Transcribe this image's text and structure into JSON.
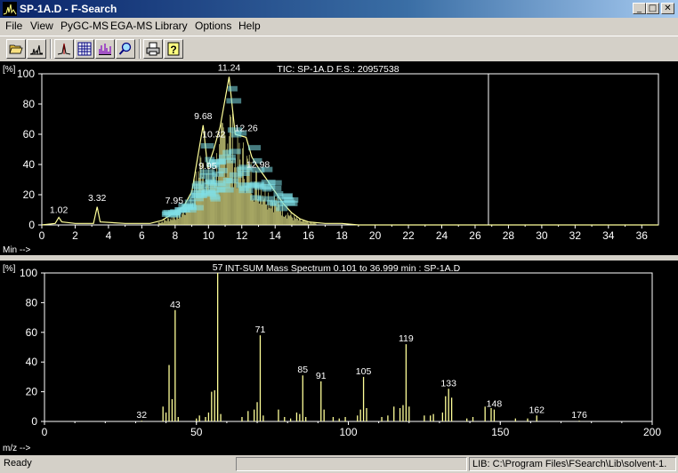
{
  "window": {
    "title": "SP-1A.D - F-Search",
    "min_glyph": "_",
    "max_glyph": "□",
    "close_glyph": "✕"
  },
  "menu": [
    "File",
    "View",
    "PyGC-MS",
    "EGA-MS",
    "Library",
    "Options",
    "Help"
  ],
  "toolbar": [
    "open-folder-icon",
    "chromatogram-icon",
    "peak-icon",
    "grid-icon",
    "spectrum-icon",
    "search-icon",
    "print-icon",
    "help-icon"
  ],
  "tic": {
    "title": "TIC: SP-1A.D   F.S.: 20957538",
    "ylabel": "[%]",
    "xlabel": "Min -->",
    "yticks": [
      "0",
      "20",
      "40",
      "60",
      "80",
      "100"
    ],
    "xticks": [
      "0",
      "2",
      "4",
      "6",
      "8",
      "10",
      "12",
      "14",
      "16",
      "18",
      "20",
      "22",
      "24",
      "26",
      "28",
      "30",
      "32",
      "34",
      "36"
    ],
    "peak_labels": [
      "1.02",
      "3.32",
      "7.95",
      "9.68",
      "9.95",
      "10.32",
      "11.24",
      "12.26",
      "12.98"
    ],
    "cursor_min": 26.8
  },
  "ms": {
    "title": "INT-SUM Mass Spectrum 0.101 to 36.999 min : SP-1A.D",
    "ylabel": "[%]",
    "xlabel": "m/z -->",
    "yticks": [
      "0",
      "20",
      "40",
      "60",
      "80",
      "100"
    ],
    "xticks": [
      "0",
      "50",
      "100",
      "150",
      "200"
    ],
    "peak_labels": [
      "32",
      "43",
      "57",
      "71",
      "85",
      "91",
      "105",
      "119",
      "133",
      "148",
      "162",
      "176"
    ]
  },
  "chart_data": [
    {
      "type": "line",
      "title": "TIC: SP-1A.D   F.S.: 20957538",
      "xlabel": "Min -->",
      "ylabel": "[%]",
      "xlim": [
        0,
        37
      ],
      "ylim": [
        0,
        100
      ],
      "x": [
        0,
        0.8,
        1.02,
        1.2,
        2,
        3.1,
        3.32,
        3.5,
        5,
        6.5,
        7.2,
        7.95,
        8.5,
        9,
        9.68,
        9.95,
        10.32,
        10.7,
        11.24,
        11.6,
        12.26,
        12.6,
        12.98,
        13.5,
        14,
        14.5,
        15,
        15.5,
        16,
        17,
        18,
        19,
        37
      ],
      "y": [
        0,
        1,
        5,
        2,
        1,
        1,
        12,
        2,
        1,
        1,
        3,
        8,
        12,
        22,
        66,
        38,
        50,
        65,
        98,
        60,
        58,
        45,
        38,
        30,
        22,
        14,
        8,
        4,
        2,
        1,
        1,
        0,
        0
      ],
      "peak_labels": [
        "1.02",
        "3.32",
        "7.95",
        "9.68",
        "9.95",
        "10.32",
        "11.24",
        "12.26",
        "12.98"
      ],
      "cursor_min": 26.8
    },
    {
      "type": "bar",
      "title": "INT-SUM Mass Spectrum 0.101 to 36.999 min : SP-1A.D",
      "xlabel": "m/z -->",
      "ylabel": "[%]",
      "xlim": [
        0,
        200
      ],
      "ylim": [
        0,
        100
      ],
      "x": [
        32,
        39,
        40,
        41,
        42,
        43,
        44,
        50,
        51,
        53,
        54,
        55,
        56,
        57,
        58,
        65,
        67,
        69,
        70,
        71,
        72,
        77,
        79,
        81,
        83,
        84,
        85,
        86,
        91,
        92,
        95,
        97,
        99,
        103,
        104,
        105,
        106,
        111,
        113,
        115,
        117,
        118,
        119,
        120,
        125,
        127,
        128,
        131,
        132,
        133,
        134,
        139,
        141,
        145,
        147,
        148,
        155,
        159,
        162,
        176
      ],
      "values": [
        0.5,
        10,
        6,
        38,
        15,
        75,
        3,
        2,
        4,
        3,
        6,
        20,
        21,
        100,
        5,
        3,
        7,
        8,
        13,
        58,
        4,
        8,
        3,
        2,
        6,
        5,
        31,
        3,
        27,
        8,
        3,
        2,
        3,
        4,
        8,
        30,
        9,
        3,
        4,
        10,
        9,
        11,
        52,
        10,
        4,
        4,
        5,
        6,
        17,
        22,
        16,
        2,
        3,
        10,
        9,
        8,
        2,
        2,
        4,
        0.5
      ]
    }
  ],
  "status": {
    "ready": "Ready",
    "lib": "LIB: C:\\Program Files\\FSearch\\Lib\\solvent-1."
  }
}
